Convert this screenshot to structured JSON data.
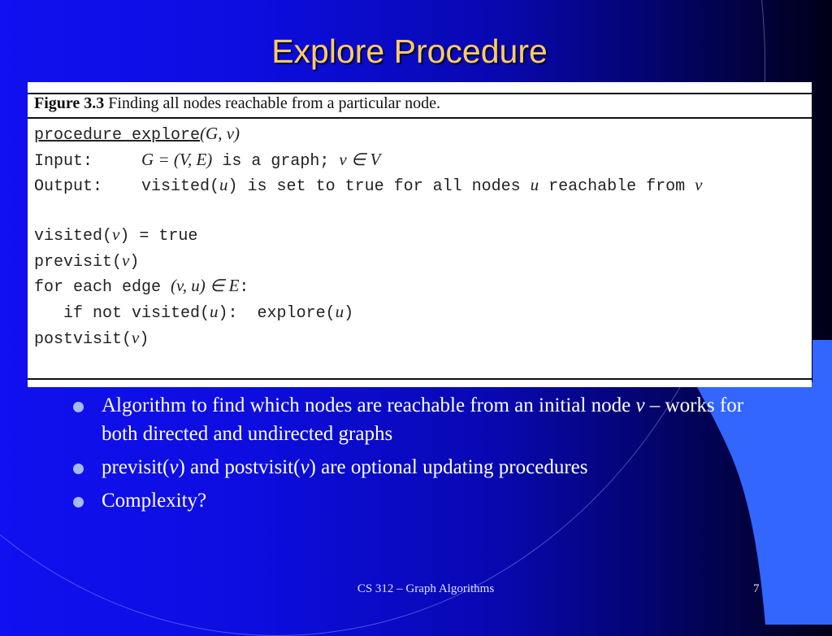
{
  "slide": {
    "title": "Explore Procedure",
    "figure": {
      "label": "Figure 3.3",
      "caption": "Finding all nodes reachable from a particular node.",
      "header_line": {
        "keyword": "procedure explore",
        "args": "(G, v)"
      },
      "input_label": "Input:",
      "input_math_a": "G = (V, E)",
      "input_text": " is a graph; ",
      "input_math_b": "v ∈ V",
      "output_label": "Output:",
      "output_text_a": "visited(",
      "output_var_u": "u",
      "output_text_b": ") is set to true for all nodes ",
      "output_var_u2": "u",
      "output_text_c": " reachable from ",
      "output_var_v": "v",
      "body": {
        "line1_a": "visited(",
        "line1_v": "v",
        "line1_b": ") = true",
        "line2_a": "previsit(",
        "line2_v": "v",
        "line2_b": ")",
        "line3_a": "for each edge ",
        "line3_m": "(v, u) ∈ E",
        "line3_b": ":",
        "line4_a": "   if not visited(",
        "line4_u": "u",
        "line4_b": "):  explore(",
        "line4_u2": "u",
        "line4_c": ")",
        "line5_a": "postvisit(",
        "line5_v": "v",
        "line5_b": ")"
      }
    },
    "bullets": [
      {
        "pre": "Algorithm to find which nodes are reachable from an initial node ",
        "var": "v",
        "post": " – works for both directed and undirected graphs"
      },
      {
        "pre": "previsit(",
        "var": "v",
        "mid": ") and postvisit(",
        "var2": "v",
        "post": ") are optional updating procedures"
      },
      {
        "pre": "Complexity?"
      }
    ],
    "footer": "CS 312 – Graph Algorithms",
    "page_number": "7"
  },
  "colors": {
    "title": "#ffcc66",
    "background_start": "#1010f0",
    "background_end": "#000018",
    "accent_shape": "#3366ff",
    "bullet_dot": "#a8b8ff"
  }
}
